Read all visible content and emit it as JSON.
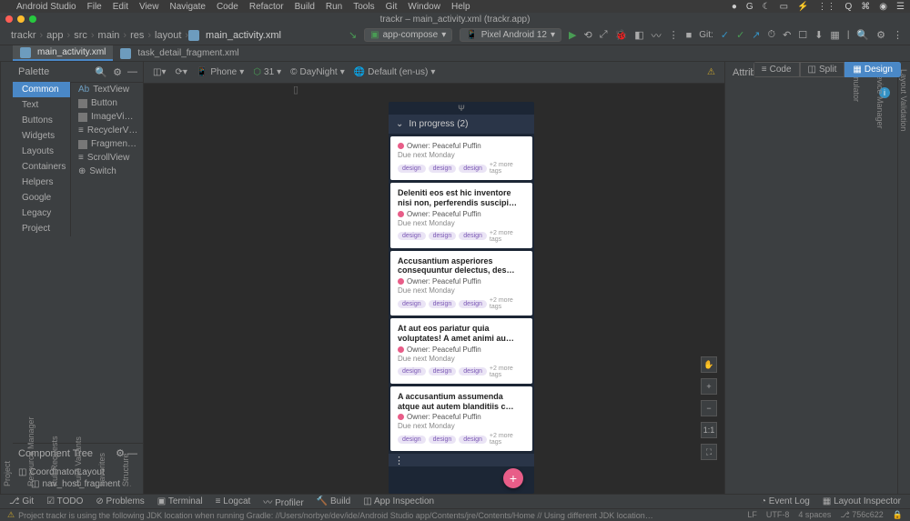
{
  "menubar": {
    "app": "Android Studio",
    "items": [
      "File",
      "Edit",
      "View",
      "Navigate",
      "Code",
      "Refactor",
      "Build",
      "Run",
      "Tools",
      "Git",
      "Window",
      "Help"
    ]
  },
  "titlebar": "trackr – main_activity.xml (trackr.app)",
  "breadcrumb": [
    "trackr",
    "app",
    "src",
    "main",
    "res",
    "layout",
    "main_activity.xml"
  ],
  "run_config": "app-compose",
  "device": "Pixel Android 12",
  "git_label": "Git:",
  "tabs": [
    {
      "label": "main_activity.xml",
      "active": true
    },
    {
      "label": "task_detail_fragment.xml",
      "active": false
    }
  ],
  "view_modes": [
    "Code",
    "Split",
    "Design"
  ],
  "palette": {
    "title": "Palette",
    "categories": [
      "Common",
      "Text",
      "Buttons",
      "Widgets",
      "Layouts",
      "Containers",
      "Helpers",
      "Google",
      "Legacy",
      "Project"
    ],
    "items": [
      "TextView",
      "Button",
      "ImageVi…",
      "RecyclerV…",
      "Fragmen…",
      "ScrollView",
      "Switch"
    ]
  },
  "component_tree": {
    "title": "Component Tree",
    "root": "CoordinatorLayout",
    "child": "nav_host_fragment"
  },
  "design_toolbar": {
    "device_type": "Phone",
    "api": "31",
    "theme": "DayNight",
    "locale": "Default (en-us)"
  },
  "attributes_title": "Attributes",
  "preview": {
    "section": "In progress (2)",
    "owner": "Owner: Peaceful Puffin",
    "due": "Due next Monday",
    "tag": "design",
    "more": "+2 more tags",
    "cards": [
      {
        "title": ""
      },
      {
        "title": "Deleniti eos est hic inventore nisi non, perferendis suscipi…"
      },
      {
        "title": "Accusantium asperiores consequuntur delectus, des…"
      },
      {
        "title": "At aut eos pariatur quia voluptates! A amet animi au…"
      },
      {
        "title": "A accusantium assumenda atque aut autem blanditiis c…"
      }
    ]
  },
  "left_rail": [
    "Project",
    "Resource Manager",
    "Pull Requests",
    "Build Variants",
    "Favorites",
    "Structure"
  ],
  "right_rail": [
    "Layout Validation",
    "Device Manager",
    "Emulator"
  ],
  "bottom_tools": {
    "left": [
      "Git",
      "TODO",
      "Problems",
      "Terminal",
      "Logcat",
      "Profiler",
      "Build",
      "App Inspection"
    ],
    "right": [
      "Event Log",
      "Layout Inspector"
    ]
  },
  "status": {
    "msg": "Project trackr is using the following JDK location when running Gradle:  //Users/norbye/dev/ide/Android Studio app/Contents/jre/Contents/Home  // Using different JDK locations on different processes mig… (a minute ago)",
    "right": [
      "LF",
      "UTF-8",
      "4 spaces",
      "756c622"
    ]
  },
  "zoom": {
    "fit": "1:1"
  }
}
